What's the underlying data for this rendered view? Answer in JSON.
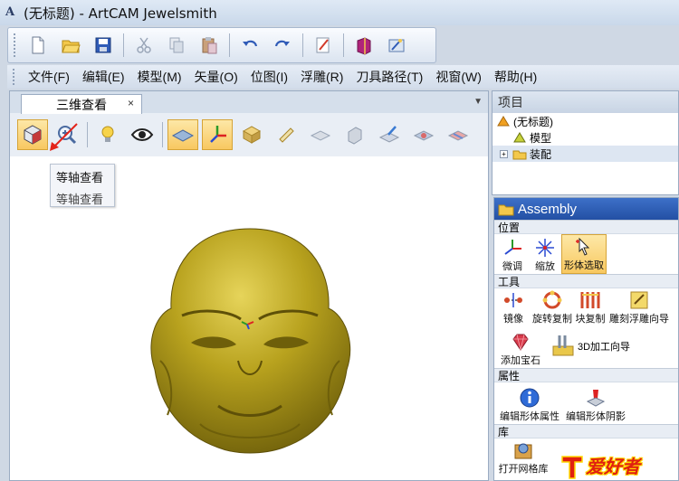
{
  "window": {
    "title": "(无标题) - ArtCAM Jewelsmith",
    "icon_glyph": "A"
  },
  "toolbar": {
    "icons": [
      "new-file-icon",
      "open-folder-icon",
      "save-icon",
      "cut-icon",
      "copy-icon",
      "paste-icon",
      "undo-icon",
      "redo-icon",
      "edit-notes-icon",
      "book-icon",
      "wizard-icon"
    ]
  },
  "menu": {
    "items": [
      "文件(F)",
      "编辑(E)",
      "模型(M)",
      "矢量(O)",
      "位图(I)",
      "浮雕(R)",
      "刀具路径(T)",
      "视窗(W)",
      "帮助(H)"
    ]
  },
  "view": {
    "tab_label": "三维查看",
    "tab_close": "×",
    "tab_menu_arrow": "▼",
    "tooltip_title": "等轴查看",
    "tooltip_desc": "等轴查看"
  },
  "project": {
    "title": "项目",
    "tree": [
      {
        "label": "(无标题)"
      },
      {
        "label": "模型"
      },
      {
        "label": "装配",
        "expander": "+"
      }
    ]
  },
  "assembly": {
    "title": "Assembly",
    "sections": {
      "position": "位置",
      "tools": "工具",
      "properties": "属性",
      "library": "库"
    },
    "position_tools": [
      "微调",
      "缩放",
      "形体选取"
    ],
    "tools_row1": [
      "镜像",
      "旋转复制",
      "块复制",
      "雕刻浮雕向导"
    ],
    "tools_row2": [
      "添加宝石",
      "3D加工向导"
    ],
    "property_tools": [
      "编辑形体属性",
      "编辑形体阴影"
    ],
    "library_tools": [
      "打开网格库"
    ]
  },
  "logo": {
    "text": "爱好者"
  },
  "colors": {
    "accent": "#f8c860",
    "asm_header": "#2350a4",
    "model_gold": "#b8a21e",
    "annotation_red": "#e3241b"
  }
}
